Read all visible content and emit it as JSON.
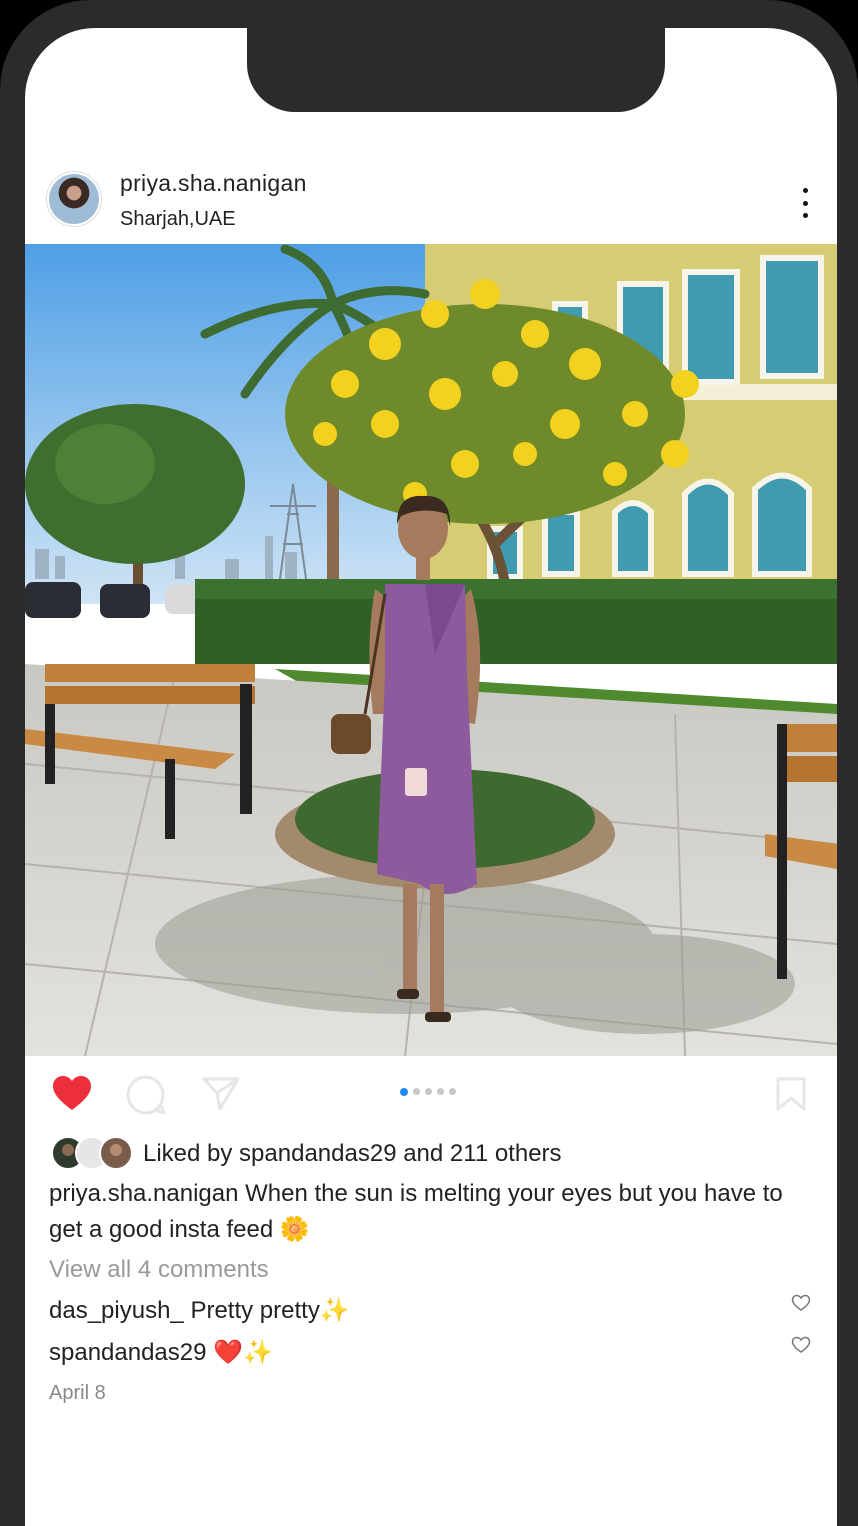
{
  "post": {
    "username": "priya.sha.nanigan",
    "location": "Sharjah,UAE",
    "liked_by_text": "Liked by spandandas29 and 211 others",
    "caption_user": "priya.sha.nanigan",
    "caption_text": "When the sun is melting your eyes but you have to get a good insta feed 🌼",
    "view_comments": "View all 4 comments",
    "comments": [
      {
        "user": "das_piyush_",
        "text": "Pretty pretty✨"
      },
      {
        "user": "spandandas29",
        "text": "❤️✨"
      }
    ],
    "date": "April 8",
    "carousel": {
      "count": 5,
      "active": 1
    },
    "liked": true
  },
  "icons": {
    "more": "more-options-icon",
    "like": "heart-icon",
    "comment": "comment-icon",
    "share": "share-icon",
    "save": "bookmark-icon",
    "comment_like": "small-heart-icon"
  },
  "colors": {
    "like_red": "#ed2f3c",
    "dot_active": "#1a8cf0",
    "frame": "#2b2b2b",
    "dress": "#8d5a9e"
  }
}
